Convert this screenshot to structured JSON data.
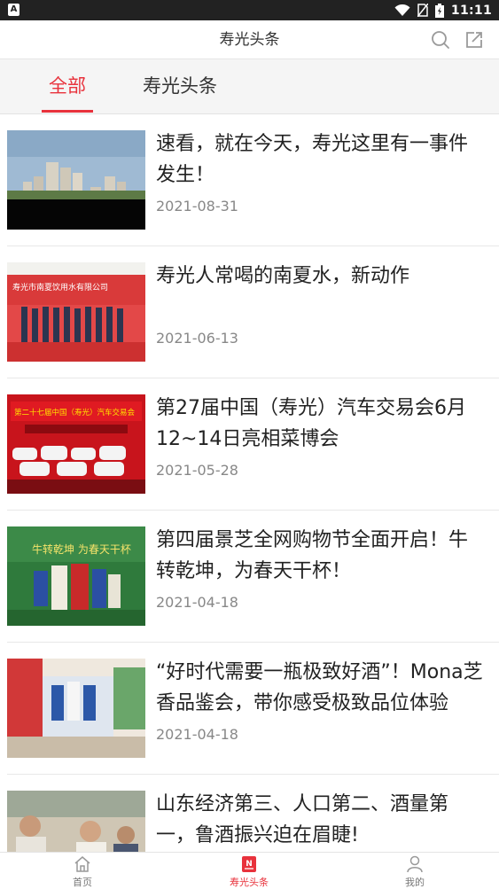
{
  "statusbar": {
    "app_badge": "A",
    "time": "11:11"
  },
  "header": {
    "title": "寿光头条",
    "search_icon": "search-icon",
    "share_icon": "share-icon"
  },
  "tabs": [
    {
      "label": "全部",
      "active": true
    },
    {
      "label": "寿光头条",
      "active": false
    }
  ],
  "articles": [
    {
      "title": "速看，就在今天，寿光这里有一事件发生！",
      "date": "2021-08-31",
      "thumb": "city-skyline"
    },
    {
      "title": "寿光人常喝的南夏水，新动作",
      "date": "2021-06-13",
      "thumb": "ceremony-red-banner",
      "thumb_text": "寿光市南夏饮用水有限公司"
    },
    {
      "title": "第27届中国（寿光）汽车交易会6月12~14日亮相菜博会",
      "date": "2021-05-28",
      "thumb": "car-expo-poster",
      "thumb_text": "第二十七届中国（寿光）汽车交易会"
    },
    {
      "title": "第四届景芝全网购物节全面开启！牛转乾坤，为春天干杯！",
      "date": "2021-04-18",
      "thumb": "liquor-promo",
      "thumb_text": "牛转乾坤 为春天干杯"
    },
    {
      "title": "“好时代需要一瓶极致好酒”！Mona芝香品鉴会，带你感受极致品位体验",
      "date": "2021-04-18",
      "thumb": "tasting-event"
    },
    {
      "title": "山东经济第三、人口第二、酒量第一，鲁酒振兴迫在眉睫!",
      "date": "",
      "thumb": "people-photo"
    }
  ],
  "bottom_nav": [
    {
      "label": "首页",
      "icon": "home-icon",
      "active": false
    },
    {
      "label": "寿光头条",
      "icon": "news-icon",
      "active": true
    },
    {
      "label": "我的",
      "icon": "profile-icon",
      "active": false
    }
  ],
  "colors": {
    "accent": "#e8323c",
    "text": "#222222",
    "muted": "#888888"
  }
}
